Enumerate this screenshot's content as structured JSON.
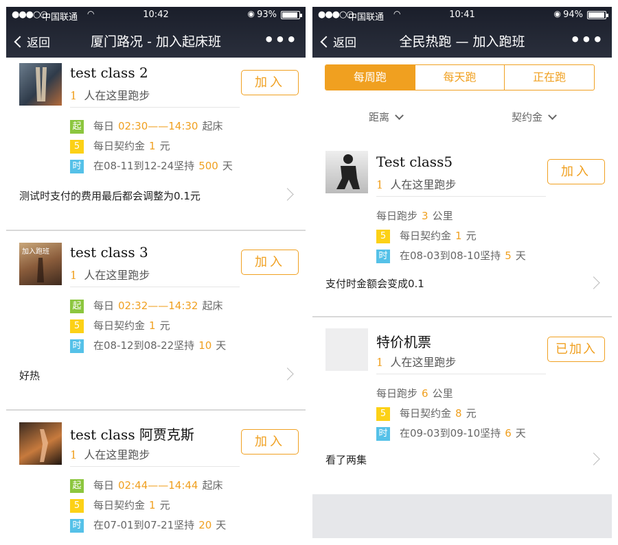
{
  "left": {
    "status": {
      "signal": "●●●○○",
      "carrier": "中国联通",
      "time": "10:42",
      "battery": "93%",
      "battery_level": 0.93
    },
    "nav": {
      "back_label": "返回",
      "title": "厦门路况 - 加入起床班",
      "more": "•••"
    },
    "classes": [
      {
        "title": "test class 2",
        "count": "1",
        "count_suffix": "人在这里跑步",
        "join_label": "加入",
        "row1_badge": "起",
        "row1_prefix": "每日",
        "row1_value": "02:30——14:30",
        "row1_suffix": "起床",
        "row2_badge": "5",
        "row2_prefix": "每日契约金",
        "row2_value": "1",
        "row2_suffix": "元",
        "row3_badge": "时",
        "row3_prefix": "在08-11到12-24坚持",
        "row3_value": "500",
        "row3_suffix": "天",
        "note": "测试时支付的费用最后都会调整为0.1元"
      },
      {
        "title": "test class 3",
        "count": "1",
        "count_suffix": "人在这里跑步",
        "join_label": "加入",
        "row1_badge": "起",
        "row1_prefix": "每日",
        "row1_value": "02:32——14:32",
        "row1_suffix": "起床",
        "row2_badge": "5",
        "row2_prefix": "每日契约金",
        "row2_value": "1",
        "row2_suffix": "元",
        "row3_badge": "时",
        "row3_prefix": "在08-12到08-22坚持",
        "row3_value": "10",
        "row3_suffix": "天",
        "note": "好热"
      },
      {
        "title": "test class 阿贾克斯",
        "count": "1",
        "count_suffix": "人在这里跑步",
        "join_label": "加入",
        "row1_badge": "起",
        "row1_prefix": "每日",
        "row1_value": "02:44——14:44",
        "row1_suffix": "起床",
        "row2_badge": "5",
        "row2_prefix": "每日契约金",
        "row2_value": "1",
        "row2_suffix": "元",
        "row3_badge": "时",
        "row3_prefix": "在07-01到07-21坚持",
        "row3_value": "20",
        "row3_suffix": "天"
      }
    ]
  },
  "right": {
    "status": {
      "signal": "●●●○○",
      "carrier": "中国联通",
      "time": "10:41",
      "battery": "94%",
      "battery_level": 0.94
    },
    "nav": {
      "back_label": "返回",
      "title": "全民热跑 — 加入跑班",
      "more": "•••"
    },
    "tabs": [
      "每周跑",
      "每天跑",
      "正在跑"
    ],
    "active_tab": "每周跑",
    "filters": {
      "distance": "距离",
      "deposit": "契约金"
    },
    "classes": [
      {
        "title": "Test class5",
        "count": "1",
        "count_suffix": "人在这里跑步",
        "join_label": "加入",
        "row1_prefix": "每日跑步",
        "row1_value": "3",
        "row1_suffix": "公里",
        "row2_badge": "5",
        "row2_prefix": "每日契约金",
        "row2_value": "1",
        "row2_suffix": "元",
        "row3_badge": "时",
        "row3_prefix": "在08-03到08-10坚持",
        "row3_value": "5",
        "row3_suffix": "天",
        "note": "支付时金额会变成0.1"
      },
      {
        "title": "特价机票",
        "count": "1",
        "count_suffix": "人在这里跑步",
        "join_label": "已加入",
        "row1_prefix": "每日跑步",
        "row1_value": "6",
        "row1_suffix": "公里",
        "row2_badge": "5",
        "row2_prefix": "每日契约金",
        "row2_value": "8",
        "row2_suffix": "元",
        "row3_badge": "时",
        "row3_prefix": "在09-03到09-10坚持",
        "row3_value": "6",
        "row3_suffix": "天",
        "note": "看了两集"
      }
    ]
  },
  "colors": {
    "accent": "#f0a020",
    "badge_green": "#8cc63e",
    "badge_yellow": "#fcd116",
    "badge_blue": "#55c1e8"
  }
}
